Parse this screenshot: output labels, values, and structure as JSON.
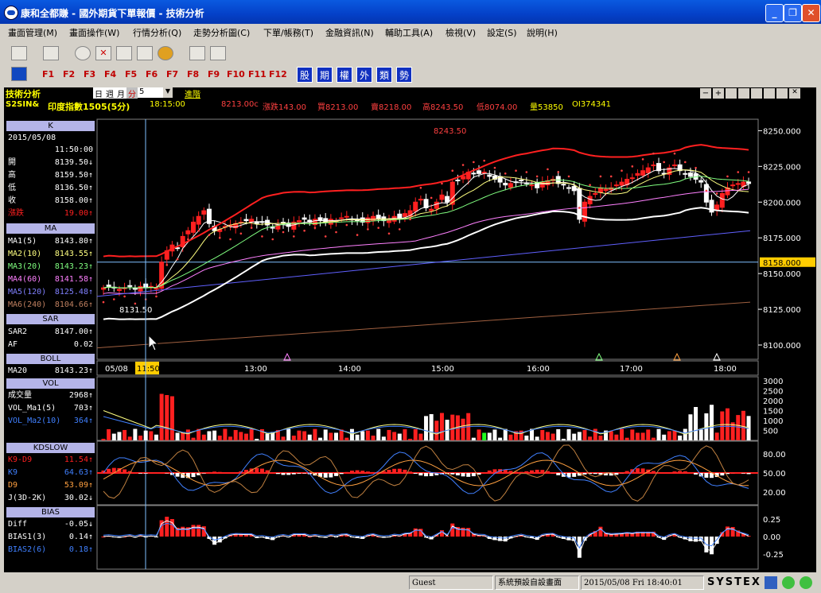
{
  "window": {
    "title": "康和全都賺 - 國外期貨下單報價 - 技術分析"
  },
  "menu": [
    "畫面管理(M)",
    "畫面操作(W)",
    "行情分析(Q)",
    "走勢分析圖(C)",
    "下單/帳務(T)",
    "金融資訊(N)",
    "輔助工具(A)",
    "檢視(V)",
    "設定(S)",
    "說明(H)"
  ],
  "fkeys": [
    "F1",
    "F2",
    "F3",
    "F4",
    "F5",
    "F6",
    "F7",
    "F8",
    "F9",
    "F10",
    "F11",
    "F12"
  ],
  "category_buttons": [
    "股",
    "期",
    "權",
    "外",
    "類",
    "勢"
  ],
  "panel": {
    "title": "技術分析",
    "periods": [
      "日",
      "週",
      "月",
      "分"
    ],
    "minute_value": "5",
    "advanced": "進階",
    "symbol": "S2SIN&",
    "name": "印度指數1505(5分)",
    "time": "18:15:00",
    "price": "8213.00c",
    "change": "漲跌143.00",
    "bid": "買8213.00",
    "ask": "賣8218.00",
    "high": "高8243.50",
    "low": "低8074.00",
    "volume": "量53850",
    "oi": "OI374341"
  },
  "left": {
    "k_head": "K",
    "date": "2015/05/08",
    "time": "11:50:00",
    "ohlc": [
      {
        "k": "開",
        "v": "8139.50↓",
        "c": "#ffffff"
      },
      {
        "k": "高",
        "v": "8159.50↑",
        "c": "#ffffff"
      },
      {
        "k": "低",
        "v": "8136.50↑",
        "c": "#ffffff"
      },
      {
        "k": "收",
        "v": "8158.00↑",
        "c": "#ffffff"
      },
      {
        "k": "漲跌",
        "v": "19.00↑",
        "c": "#ff2020"
      }
    ],
    "ma_head": "MA",
    "ma": [
      {
        "k": "MA1(5)",
        "v": "8143.80↑",
        "c": "#ffffff"
      },
      {
        "k": "MA2(10)",
        "v": "8143.55↑",
        "c": "#ffff80"
      },
      {
        "k": "MA3(20)",
        "v": "8143.23↑",
        "c": "#80ff80"
      },
      {
        "k": "MA4(60)",
        "v": "8141.58↑",
        "c": "#ff80ff"
      },
      {
        "k": "MA5(120)",
        "v": "8125.48↑",
        "c": "#8080ff"
      },
      {
        "k": "MA6(240)",
        "v": "8104.66↑",
        "c": "#c08060"
      }
    ],
    "sar_head": "SAR",
    "sar": [
      {
        "k": "SAR2",
        "v": "8147.00↑",
        "c": "#ffffff"
      },
      {
        "k": "AF",
        "v": "0.02",
        "c": "#ffffff"
      }
    ],
    "boll_head": "BOLL",
    "boll": [
      {
        "k": "MA20",
        "v": "8143.23↑",
        "c": "#ffffff"
      }
    ],
    "vol_head": "VOL",
    "vol": [
      {
        "k": "成交量",
        "v": "2968↑",
        "c": "#ffffff"
      },
      {
        "k": "VOL_Ma1(5)",
        "v": "703↑",
        "c": "#ffffff"
      },
      {
        "k": "VOL_Ma2(10)",
        "v": "364↑",
        "c": "#4080ff"
      }
    ],
    "kd_head": "KDSLOW",
    "kd": [
      {
        "k": "K9-D9",
        "v": "11.54↑",
        "c": "#ff2020"
      },
      {
        "k": "K9",
        "v": "64.63↑",
        "c": "#4080ff"
      },
      {
        "k": "D9",
        "v": "53.09↑",
        "c": "#ffa040"
      },
      {
        "k": "J(3D-2K)",
        "v": "30.02↓",
        "c": "#ffffff"
      }
    ],
    "bias_head": "BIAS",
    "bias": [
      {
        "k": "Diff",
        "v": "-0.05↓",
        "c": "#ffffff"
      },
      {
        "k": "BIAS1(3)",
        "v": "0.14↑",
        "c": "#ffffff"
      },
      {
        "k": "BIAS2(6)",
        "v": "0.18↑",
        "c": "#4080ff"
      }
    ]
  },
  "axis": {
    "price_ticks": [
      "8250.000",
      "8225.000",
      "8200.000",
      "8175.000",
      "8150.000",
      "8125.000",
      "8100.000"
    ],
    "current_price": "8158.000",
    "time_ticks": [
      "05/08",
      "11:50",
      "13:00",
      "14:00",
      "15:00",
      "16:00",
      "17:00",
      "18:00"
    ],
    "vol_ticks": [
      "3000",
      "2500",
      "2000",
      "1500",
      "1000",
      "500"
    ],
    "kd_ticks": [
      "80.00",
      "50.00",
      "20.00"
    ],
    "bias_ticks": [
      "0.25",
      "0.00",
      "-0.25"
    ],
    "high_label": "8243.50",
    "low_label": "8131.50"
  },
  "chart_data": {
    "type": "candlestick",
    "interval": "5 min",
    "symbol": "S2SIN&",
    "title": "印度指數1505(5分)",
    "price_range": [
      8090,
      8258
    ],
    "high": 8243.5,
    "low": 8131.5,
    "last": 8158.0,
    "time_labels": [
      "11:50",
      "13:00",
      "14:00",
      "15:00",
      "16:00",
      "17:00",
      "18:00"
    ],
    "series": [
      {
        "name": "MA1(5)",
        "last": 8143.8
      },
      {
        "name": "MA2(10)",
        "last": 8143.55
      },
      {
        "name": "MA3(20)",
        "last": 8143.23
      },
      {
        "name": "MA4(60)",
        "last": 8141.58
      },
      {
        "name": "MA5(120)",
        "last": 8125.48
      },
      {
        "name": "MA6(240)",
        "last": 8104.66
      },
      {
        "name": "SAR2",
        "last": 8147.0
      },
      {
        "name": "MA20",
        "last": 8143.23
      },
      {
        "name": "成交量",
        "last": 2968
      },
      {
        "name": "VOL_Ma1(5)",
        "last": 703
      },
      {
        "name": "VOL_Ma2(10)",
        "last": 364
      },
      {
        "name": "K9-D9",
        "last": 11.54
      },
      {
        "name": "K9",
        "last": 64.63
      },
      {
        "name": "D9",
        "last": 53.09
      },
      {
        "name": "J(3D-2K)",
        "last": 30.02
      },
      {
        "name": "Diff",
        "last": -0.05
      },
      {
        "name": "BIAS1(3)",
        "last": 0.14
      },
      {
        "name": "BIAS2(6)",
        "last": 0.18
      }
    ],
    "closes": [
      8140,
      8141,
      8140,
      8139,
      8140,
      8141,
      8139,
      8141,
      8140,
      8141,
      8140,
      8158,
      8166,
      8170,
      8168,
      8176,
      8180,
      8186,
      8190,
      8194,
      8185,
      8180,
      8181,
      8183,
      8184,
      8185,
      8186,
      8187,
      8188,
      8185,
      8186,
      8184,
      8182,
      8184,
      8185,
      8183,
      8186,
      8187,
      8188,
      8186,
      8188,
      8187,
      8186,
      8188,
      8187,
      8189,
      8190,
      8188,
      8187,
      8186,
      8189,
      8190,
      8188,
      8187,
      8188,
      8190,
      8189,
      8192,
      8194,
      8200,
      8202,
      8196,
      8195,
      8200,
      8205,
      8200,
      8214,
      8215,
      8218,
      8221,
      8220,
      8220,
      8221,
      8218,
      8216,
      8214,
      8212,
      8213,
      8214,
      8215,
      8213,
      8212,
      8210,
      8214,
      8215,
      8216,
      8213,
      8212,
      8210,
      8208,
      8188,
      8200,
      8204,
      8206,
      8210,
      8209,
      8210,
      8212,
      8214,
      8216,
      8217,
      8220,
      8222,
      8224,
      8226,
      8222,
      8220,
      8224,
      8226,
      8222,
      8220,
      8218,
      8216,
      8214,
      8200,
      8193,
      8198,
      8206,
      8210,
      8212,
      8213,
      8214,
      8213
    ]
  },
  "status": {
    "user": "Guest",
    "screen": "系統預設自設畫面",
    "datetime": "2015/05/08 Fri 18:40:01",
    "brand": "SYSTEX"
  }
}
